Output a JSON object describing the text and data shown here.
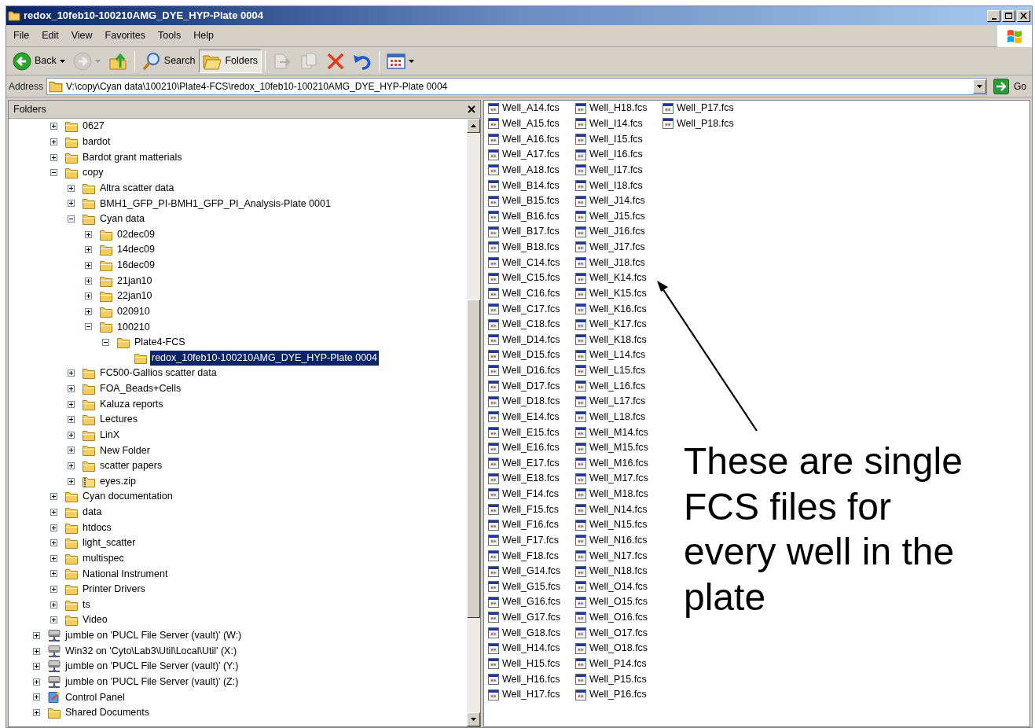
{
  "window": {
    "title": "redox_10feb10-100210AMG_DYE_HYP-Plate 0004"
  },
  "menu": [
    "File",
    "Edit",
    "View",
    "Favorites",
    "Tools",
    "Help"
  ],
  "toolbar": [
    {
      "kind": "back",
      "label": "Back",
      "disabled": false,
      "pressed": false,
      "dropdown": true
    },
    {
      "kind": "forward",
      "disabled": true,
      "pressed": false,
      "dropdown": true
    },
    {
      "kind": "up",
      "disabled": false,
      "pressed": false,
      "dropdown": false
    },
    {
      "kind": "search",
      "label": "Search",
      "disabled": false,
      "pressed": false,
      "dropdown": false
    },
    {
      "kind": "folders",
      "label": "Folders",
      "disabled": false,
      "pressed": true,
      "dropdown": false
    },
    {
      "kind": "move",
      "disabled": true,
      "pressed": false,
      "dropdown": false
    },
    {
      "kind": "copy",
      "disabled": true,
      "pressed": false,
      "dropdown": false
    },
    {
      "kind": "delete",
      "disabled": false,
      "pressed": false,
      "dropdown": false
    },
    {
      "kind": "undo",
      "disabled": false,
      "pressed": false,
      "dropdown": false
    },
    {
      "kind": "views",
      "disabled": false,
      "pressed": false,
      "dropdown": true
    }
  ],
  "address": {
    "label": "Address",
    "value": "V:\\copy\\Cyan data\\100210\\Plate4-FCS\\redox_10feb10-100210AMG_DYE_HYP-Plate 0004",
    "go": "Go"
  },
  "folders_pane": {
    "title": "Folders",
    "scrolled_branch": [
      {
        "label": "0627",
        "kind": "folder",
        "expandable": true,
        "expanded": false,
        "selected": false
      },
      {
        "label": "bardot",
        "kind": "folder",
        "expandable": true,
        "expanded": false,
        "selected": false
      },
      {
        "label": "Bardot grant matterials",
        "kind": "folder",
        "expandable": true,
        "expanded": false,
        "selected": false
      },
      {
        "label": "copy",
        "kind": "folder",
        "expandable": true,
        "expanded": true,
        "selected": false,
        "children": [
          {
            "label": "Altra scatter data",
            "kind": "folder",
            "expandable": true,
            "expanded": false,
            "selected": false
          },
          {
            "label": "BMH1_GFP_PI-BMH1_GFP_PI_Analysis-Plate 0001",
            "kind": "folder",
            "expandable": true,
            "expanded": false,
            "selected": false
          },
          {
            "label": "Cyan data",
            "kind": "folder",
            "expandable": true,
            "expanded": true,
            "selected": false,
            "children": [
              {
                "label": "02dec09",
                "kind": "folder",
                "expandable": true,
                "expanded": false,
                "selected": false
              },
              {
                "label": "14dec09",
                "kind": "folder",
                "expandable": true,
                "expanded": false,
                "selected": false
              },
              {
                "label": "16dec09",
                "kind": "folder",
                "expandable": true,
                "expanded": false,
                "selected": false
              },
              {
                "label": "21jan10",
                "kind": "folder",
                "expandable": true,
                "expanded": false,
                "selected": false
              },
              {
                "label": "22jan10",
                "kind": "folder",
                "expandable": true,
                "expanded": false,
                "selected": false
              },
              {
                "label": "020910",
                "kind": "folder",
                "expandable": true,
                "expanded": false,
                "selected": false
              },
              {
                "label": "100210",
                "kind": "folder",
                "expandable": true,
                "expanded": true,
                "selected": false,
                "children": [
                  {
                    "label": "Plate4-FCS",
                    "kind": "folder",
                    "expandable": true,
                    "expanded": true,
                    "selected": false,
                    "children": [
                      {
                        "label": "redox_10feb10-100210AMG_DYE_HYP-Plate 0004",
                        "kind": "folder",
                        "expandable": false,
                        "selected": true
                      }
                    ]
                  }
                ]
              }
            ]
          },
          {
            "label": "FC500-Gallios scatter data",
            "kind": "folder",
            "expandable": true,
            "expanded": false,
            "selected": false
          },
          {
            "label": "FOA_Beads+Cells",
            "kind": "folder",
            "expandable": true,
            "expanded": false,
            "selected": false
          },
          {
            "label": "Kaluza reports",
            "kind": "folder",
            "expandable": true,
            "expanded": false,
            "selected": false
          },
          {
            "label": "Lectures",
            "kind": "folder",
            "expandable": true,
            "expanded": false,
            "selected": false
          },
          {
            "label": "LinX",
            "kind": "folder",
            "expandable": true,
            "expanded": false,
            "selected": false
          },
          {
            "label": "New Folder",
            "kind": "folder",
            "expandable": true,
            "expanded": false,
            "selected": false
          },
          {
            "label": "scatter papers",
            "kind": "folder",
            "expandable": true,
            "expanded": false,
            "selected": false
          },
          {
            "label": "eyes.zip",
            "kind": "zip",
            "expandable": true,
            "expanded": false,
            "selected": false
          }
        ]
      },
      {
        "label": "Cyan documentation",
        "kind": "folder",
        "expandable": true,
        "expanded": false,
        "selected": false
      },
      {
        "label": "data",
        "kind": "folder",
        "expandable": true,
        "expanded": false,
        "selected": false
      },
      {
        "label": "htdocs",
        "kind": "folder",
        "expandable": true,
        "expanded": false,
        "selected": false
      },
      {
        "label": "light_scatter",
        "kind": "folder",
        "expandable": true,
        "expanded": false,
        "selected": false
      },
      {
        "label": "multispec",
        "kind": "folder",
        "expandable": true,
        "expanded": false,
        "selected": false
      },
      {
        "label": "National Instrument",
        "kind": "folder",
        "expandable": true,
        "expanded": false,
        "selected": false
      },
      {
        "label": "Printer Drivers",
        "kind": "folder",
        "expandable": true,
        "expanded": false,
        "selected": false
      },
      {
        "label": "ts",
        "kind": "folder",
        "expandable": true,
        "expanded": false,
        "selected": false
      },
      {
        "label": "Video",
        "kind": "folder",
        "expandable": true,
        "expanded": false,
        "selected": false
      }
    ],
    "tree": [
      {
        "label": "jumble on 'PUCL File Server (vault)' (W:)",
        "kind": "network-drive",
        "expandable": true,
        "expanded": false,
        "selected": false
      },
      {
        "label": "Win32 on 'Cyto\\Lab3\\Util\\Local\\Util' (X:)",
        "kind": "network-drive",
        "expandable": true,
        "expanded": false,
        "selected": false
      },
      {
        "label": "jumble on 'PUCL File Server (vault)' (Y:)",
        "kind": "network-drive",
        "expandable": true,
        "expanded": false,
        "selected": false
      },
      {
        "label": "jumble on 'PUCL File Server (vault)' (Z:)",
        "kind": "network-drive",
        "expandable": true,
        "expanded": false,
        "selected": false
      },
      {
        "label": "Control Panel",
        "kind": "control-panel",
        "expandable": true,
        "expanded": false,
        "selected": false
      },
      {
        "label": "Shared Documents",
        "kind": "folder",
        "expandable": true,
        "expanded": false,
        "selected": false
      }
    ]
  },
  "files": [
    "Well_A14.fcs",
    "Well_A15.fcs",
    "Well_A16.fcs",
    "Well_A17.fcs",
    "Well_A18.fcs",
    "Well_B14.fcs",
    "Well_B15.fcs",
    "Well_B16.fcs",
    "Well_B17.fcs",
    "Well_B18.fcs",
    "Well_C14.fcs",
    "Well_C15.fcs",
    "Well_C16.fcs",
    "Well_C17.fcs",
    "Well_C18.fcs",
    "Well_D14.fcs",
    "Well_D15.fcs",
    "Well_D16.fcs",
    "Well_D17.fcs",
    "Well_D18.fcs",
    "Well_E14.fcs",
    "Well_E15.fcs",
    "Well_E16.fcs",
    "Well_E17.fcs",
    "Well_E18.fcs",
    "Well_F14.fcs",
    "Well_F15.fcs",
    "Well_F16.fcs",
    "Well_F17.fcs",
    "Well_F18.fcs",
    "Well_G14.fcs",
    "Well_G15.fcs",
    "Well_G16.fcs",
    "Well_G17.fcs",
    "Well_G18.fcs",
    "Well_H14.fcs",
    "Well_H15.fcs",
    "Well_H16.fcs",
    "Well_H17.fcs",
    "Well_H18.fcs",
    "Well_I14.fcs",
    "Well_I15.fcs",
    "Well_I16.fcs",
    "Well_I17.fcs",
    "Well_I18.fcs",
    "Well_J14.fcs",
    "Well_J15.fcs",
    "Well_J16.fcs",
    "Well_J17.fcs",
    "Well_J18.fcs",
    "Well_K14.fcs",
    "Well_K15.fcs",
    "Well_K16.fcs",
    "Well_K17.fcs",
    "Well_K18.fcs",
    "Well_L14.fcs",
    "Well_L15.fcs",
    "Well_L16.fcs",
    "Well_L17.fcs",
    "Well_L18.fcs",
    "Well_M14.fcs",
    "Well_M15.fcs",
    "Well_M16.fcs",
    "Well_M17.fcs",
    "Well_M18.fcs",
    "Well_N14.fcs",
    "Well_N15.fcs",
    "Well_N16.fcs",
    "Well_N17.fcs",
    "Well_N18.fcs",
    "Well_O14.fcs",
    "Well_O15.fcs",
    "Well_O16.fcs",
    "Well_O17.fcs",
    "Well_O18.fcs",
    "Well_P14.fcs",
    "Well_P15.fcs",
    "Well_P16.fcs",
    "Well_P17.fcs",
    "Well_P18.fcs"
  ],
  "annotation": {
    "text": "These are single FCS files for every well in the plate"
  }
}
